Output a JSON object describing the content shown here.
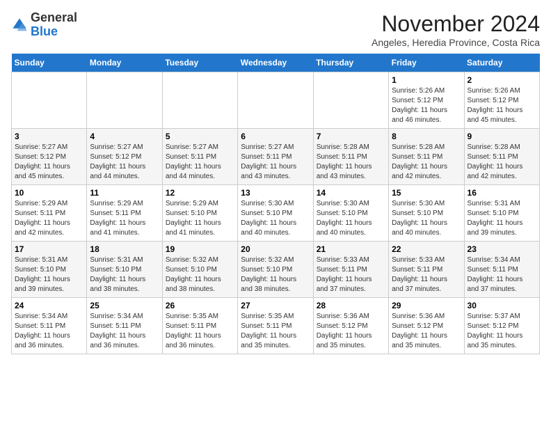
{
  "header": {
    "logo_general": "General",
    "logo_blue": "Blue",
    "month_title": "November 2024",
    "location": "Angeles, Heredia Province, Costa Rica"
  },
  "weekdays": [
    "Sunday",
    "Monday",
    "Tuesday",
    "Wednesday",
    "Thursday",
    "Friday",
    "Saturday"
  ],
  "weeks": [
    {
      "days": [
        {
          "num": "",
          "info": ""
        },
        {
          "num": "",
          "info": ""
        },
        {
          "num": "",
          "info": ""
        },
        {
          "num": "",
          "info": ""
        },
        {
          "num": "",
          "info": ""
        },
        {
          "num": "1",
          "info": "Sunrise: 5:26 AM\nSunset: 5:12 PM\nDaylight: 11 hours\nand 46 minutes."
        },
        {
          "num": "2",
          "info": "Sunrise: 5:26 AM\nSunset: 5:12 PM\nDaylight: 11 hours\nand 45 minutes."
        }
      ]
    },
    {
      "days": [
        {
          "num": "3",
          "info": "Sunrise: 5:27 AM\nSunset: 5:12 PM\nDaylight: 11 hours\nand 45 minutes."
        },
        {
          "num": "4",
          "info": "Sunrise: 5:27 AM\nSunset: 5:12 PM\nDaylight: 11 hours\nand 44 minutes."
        },
        {
          "num": "5",
          "info": "Sunrise: 5:27 AM\nSunset: 5:11 PM\nDaylight: 11 hours\nand 44 minutes."
        },
        {
          "num": "6",
          "info": "Sunrise: 5:27 AM\nSunset: 5:11 PM\nDaylight: 11 hours\nand 43 minutes."
        },
        {
          "num": "7",
          "info": "Sunrise: 5:28 AM\nSunset: 5:11 PM\nDaylight: 11 hours\nand 43 minutes."
        },
        {
          "num": "8",
          "info": "Sunrise: 5:28 AM\nSunset: 5:11 PM\nDaylight: 11 hours\nand 42 minutes."
        },
        {
          "num": "9",
          "info": "Sunrise: 5:28 AM\nSunset: 5:11 PM\nDaylight: 11 hours\nand 42 minutes."
        }
      ]
    },
    {
      "days": [
        {
          "num": "10",
          "info": "Sunrise: 5:29 AM\nSunset: 5:11 PM\nDaylight: 11 hours\nand 42 minutes."
        },
        {
          "num": "11",
          "info": "Sunrise: 5:29 AM\nSunset: 5:11 PM\nDaylight: 11 hours\nand 41 minutes."
        },
        {
          "num": "12",
          "info": "Sunrise: 5:29 AM\nSunset: 5:10 PM\nDaylight: 11 hours\nand 41 minutes."
        },
        {
          "num": "13",
          "info": "Sunrise: 5:30 AM\nSunset: 5:10 PM\nDaylight: 11 hours\nand 40 minutes."
        },
        {
          "num": "14",
          "info": "Sunrise: 5:30 AM\nSunset: 5:10 PM\nDaylight: 11 hours\nand 40 minutes."
        },
        {
          "num": "15",
          "info": "Sunrise: 5:30 AM\nSunset: 5:10 PM\nDaylight: 11 hours\nand 40 minutes."
        },
        {
          "num": "16",
          "info": "Sunrise: 5:31 AM\nSunset: 5:10 PM\nDaylight: 11 hours\nand 39 minutes."
        }
      ]
    },
    {
      "days": [
        {
          "num": "17",
          "info": "Sunrise: 5:31 AM\nSunset: 5:10 PM\nDaylight: 11 hours\nand 39 minutes."
        },
        {
          "num": "18",
          "info": "Sunrise: 5:31 AM\nSunset: 5:10 PM\nDaylight: 11 hours\nand 38 minutes."
        },
        {
          "num": "19",
          "info": "Sunrise: 5:32 AM\nSunset: 5:10 PM\nDaylight: 11 hours\nand 38 minutes."
        },
        {
          "num": "20",
          "info": "Sunrise: 5:32 AM\nSunset: 5:10 PM\nDaylight: 11 hours\nand 38 minutes."
        },
        {
          "num": "21",
          "info": "Sunrise: 5:33 AM\nSunset: 5:11 PM\nDaylight: 11 hours\nand 37 minutes."
        },
        {
          "num": "22",
          "info": "Sunrise: 5:33 AM\nSunset: 5:11 PM\nDaylight: 11 hours\nand 37 minutes."
        },
        {
          "num": "23",
          "info": "Sunrise: 5:34 AM\nSunset: 5:11 PM\nDaylight: 11 hours\nand 37 minutes."
        }
      ]
    },
    {
      "days": [
        {
          "num": "24",
          "info": "Sunrise: 5:34 AM\nSunset: 5:11 PM\nDaylight: 11 hours\nand 36 minutes."
        },
        {
          "num": "25",
          "info": "Sunrise: 5:34 AM\nSunset: 5:11 PM\nDaylight: 11 hours\nand 36 minutes."
        },
        {
          "num": "26",
          "info": "Sunrise: 5:35 AM\nSunset: 5:11 PM\nDaylight: 11 hours\nand 36 minutes."
        },
        {
          "num": "27",
          "info": "Sunrise: 5:35 AM\nSunset: 5:11 PM\nDaylight: 11 hours\nand 35 minutes."
        },
        {
          "num": "28",
          "info": "Sunrise: 5:36 AM\nSunset: 5:12 PM\nDaylight: 11 hours\nand 35 minutes."
        },
        {
          "num": "29",
          "info": "Sunrise: 5:36 AM\nSunset: 5:12 PM\nDaylight: 11 hours\nand 35 minutes."
        },
        {
          "num": "30",
          "info": "Sunrise: 5:37 AM\nSunset: 5:12 PM\nDaylight: 11 hours\nand 35 minutes."
        }
      ]
    }
  ]
}
